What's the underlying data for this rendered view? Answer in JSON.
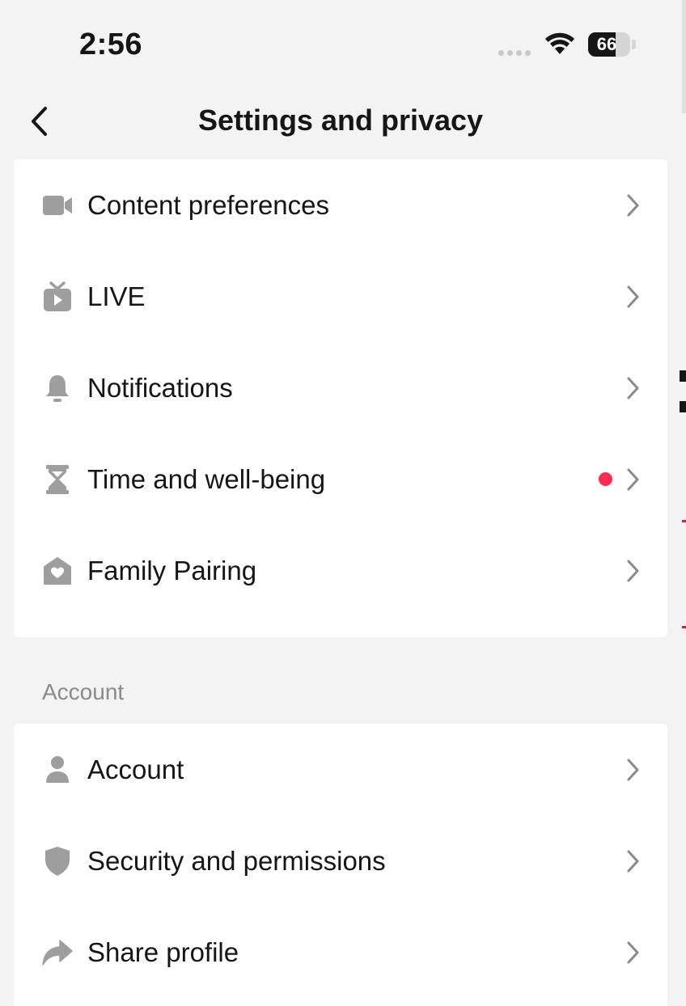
{
  "status_bar": {
    "time": "2:56",
    "battery_percent": "66",
    "battery_level": 0.66
  },
  "header": {
    "title": "Settings and privacy"
  },
  "groups": [
    {
      "items": [
        {
          "label": "Content preferences",
          "icon": "video-camera-icon"
        },
        {
          "label": "LIVE",
          "icon": "live-tv-icon"
        },
        {
          "label": "Notifications",
          "icon": "bell-icon"
        },
        {
          "label": "Time and well-being",
          "icon": "hourglass-icon",
          "badge_dot": true
        },
        {
          "label": "Family Pairing",
          "icon": "family-home-icon"
        }
      ]
    },
    {
      "section_title": "Account",
      "items": [
        {
          "label": "Account",
          "icon": "person-icon"
        },
        {
          "label": "Security and permissions",
          "icon": "shield-icon"
        },
        {
          "label": "Share profile",
          "icon": "share-arrow-icon"
        }
      ]
    }
  ],
  "colors": {
    "background": "#f3f3f3",
    "card": "#ffffff",
    "text": "#161616",
    "icon": "#9e9e9e",
    "chevron": "#8a8a8a",
    "badge": "#fe2c55"
  }
}
